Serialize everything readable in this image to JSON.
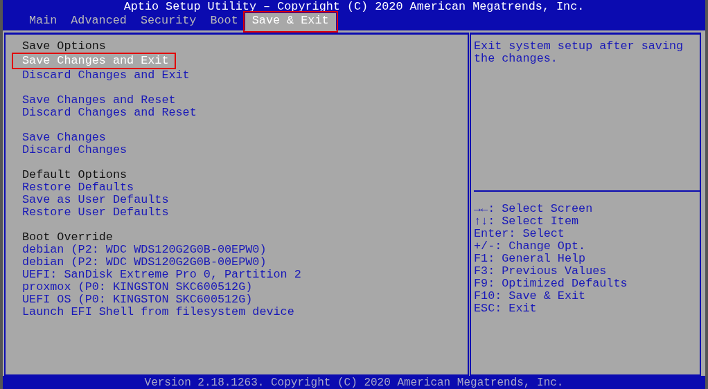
{
  "window": {
    "title": "Aptio Setup Utility – Copyright (C) 2020 American Megatrends, Inc."
  },
  "tabs": [
    {
      "label": "Main",
      "selected": false,
      "highlighted": false
    },
    {
      "label": "Advanced",
      "selected": false,
      "highlighted": false
    },
    {
      "label": "Security",
      "selected": false,
      "highlighted": false
    },
    {
      "label": "Boot",
      "selected": false,
      "highlighted": false
    },
    {
      "label": "Save & Exit",
      "selected": true,
      "highlighted": true
    }
  ],
  "menu": {
    "groups": [
      {
        "items": [
          {
            "kind": "header",
            "text": "Save Options"
          },
          {
            "kind": "option",
            "text": "Save Changes and Exit",
            "selected": true,
            "highlighted": true
          },
          {
            "kind": "option",
            "text": "Discard Changes and Exit",
            "selected": false,
            "highlighted": false
          }
        ]
      },
      {
        "items": [
          {
            "kind": "option",
            "text": "Save Changes and Reset",
            "selected": false,
            "highlighted": false
          },
          {
            "kind": "option",
            "text": "Discard Changes and Reset",
            "selected": false,
            "highlighted": false
          }
        ]
      },
      {
        "items": [
          {
            "kind": "option",
            "text": "Save Changes",
            "selected": false,
            "highlighted": false
          },
          {
            "kind": "option",
            "text": "Discard Changes",
            "selected": false,
            "highlighted": false
          }
        ]
      },
      {
        "items": [
          {
            "kind": "header",
            "text": "Default Options"
          },
          {
            "kind": "option",
            "text": "Restore Defaults",
            "selected": false,
            "highlighted": false
          },
          {
            "kind": "option",
            "text": "Save as User Defaults",
            "selected": false,
            "highlighted": false
          },
          {
            "kind": "option",
            "text": "Restore User Defaults",
            "selected": false,
            "highlighted": false
          }
        ]
      },
      {
        "items": [
          {
            "kind": "header",
            "text": "Boot Override"
          },
          {
            "kind": "option",
            "text": "debian (P2: WDC WDS120G2G0B-00EPW0)",
            "selected": false,
            "highlighted": false
          },
          {
            "kind": "option",
            "text": "debian (P2: WDC WDS120G2G0B-00EPW0)",
            "selected": false,
            "highlighted": false
          },
          {
            "kind": "option",
            "text": "UEFI: SanDisk Extreme Pro 0, Partition 2",
            "selected": false,
            "highlighted": false
          },
          {
            "kind": "option",
            "text": "proxmox (P0: KINGSTON SKC600512G)",
            "selected": false,
            "highlighted": false
          },
          {
            "kind": "option",
            "text": "UEFI OS (P0: KINGSTON SKC600512G)",
            "selected": false,
            "highlighted": false
          },
          {
            "kind": "option",
            "text": "Launch EFI Shell from filesystem device",
            "selected": false,
            "highlighted": false
          }
        ]
      }
    ]
  },
  "help": {
    "text": "Exit system setup after saving the changes.",
    "keys": [
      "→←: Select Screen",
      "↑↓: Select Item",
      "Enter: Select",
      "+/-: Change Opt.",
      "F1: General Help",
      "F3: Previous Values",
      "F9: Optimized Defaults",
      "F10: Save & Exit",
      "ESC: Exit"
    ]
  },
  "status_bar": {
    "text": "Version 2.18.1263. Copyright (C) 2020 American Megatrends, Inc."
  }
}
